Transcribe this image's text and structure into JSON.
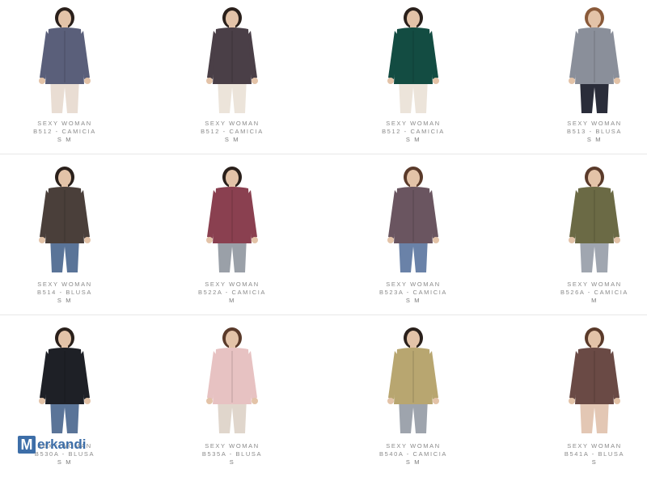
{
  "watermark": {
    "first_letter": "M",
    "rest": "erkandi"
  },
  "products": [
    {
      "brand": "SEXY WOMAN",
      "code": "B512 - CAMICIA",
      "sizes": "S  M",
      "top": "#5a5f7a",
      "pants": "#e9ddd3",
      "skin": "#e3c3a8",
      "hair": "#2a201b"
    },
    {
      "brand": "SEXY WOMAN",
      "code": "B512 - CAMICIA",
      "sizes": "S  M",
      "top": "#4a3f47",
      "pants": "#ece4da",
      "skin": "#e3c3a8",
      "hair": "#2a201b"
    },
    {
      "brand": "SEXY WOMAN",
      "code": "B512 - CAMICIA",
      "sizes": "S  M",
      "top": "#134c42",
      "pants": "#ece4da",
      "skin": "#e3c3a8",
      "hair": "#2a201b"
    },
    {
      "brand": "SEXY WOMAN",
      "code": "B513 - BLUSA",
      "sizes": "S  M",
      "top": "#8a8f9a",
      "pants": "#2a2d3a",
      "skin": "#e3c3a8",
      "hair": "#8a5a3a"
    },
    {
      "brand": "SEXY WOMAN",
      "code": "B514 - BLUSA",
      "sizes": "S  M",
      "top": "#4a3f3a",
      "pants": "#5a7498",
      "skin": "#e3c3a8",
      "hair": "#2a201b"
    },
    {
      "brand": "SEXY WOMAN",
      "code": "B522A - CAMICIA",
      "sizes": "M",
      "top": "#8a4050",
      "pants": "#9aa0a8",
      "skin": "#e3c3a8",
      "hair": "#2a201b"
    },
    {
      "brand": "SEXY WOMAN",
      "code": "B523A - CAMICIA",
      "sizes": "S  M",
      "top": "#6a5560",
      "pants": "#6a82a8",
      "skin": "#e3c3a8",
      "hair": "#5a3a2a"
    },
    {
      "brand": "SEXY WOMAN",
      "code": "B526A - CAMICIA",
      "sizes": "M",
      "top": "#6b6a45",
      "pants": "#a0a6b0",
      "skin": "#e3c3a8",
      "hair": "#5a3a2a"
    },
    {
      "brand": "SEXY WOMAN",
      "code": "B530A - BLUSA",
      "sizes": "S  M",
      "top": "#1e2026",
      "pants": "#5a7498",
      "skin": "#e3c3a8",
      "hair": "#2a201b"
    },
    {
      "brand": "SEXY WOMAN",
      "code": "B535A - BLUSA",
      "sizes": "S",
      "top": "#e7c2c2",
      "pants": "#e0d6cc",
      "skin": "#e3c3a8",
      "hair": "#5a3a2a"
    },
    {
      "brand": "SEXY WOMAN",
      "code": "B540A - CAMICIA",
      "sizes": "S  M",
      "top": "#b8a670",
      "pants": "#9ea4ad",
      "skin": "#e3c3a8",
      "hair": "#2a201b"
    },
    {
      "brand": "SEXY WOMAN",
      "code": "B541A - BLUSA",
      "sizes": "S",
      "top": "#6a4a45",
      "pants": "#e3c7b4",
      "skin": "#e3c3a8",
      "hair": "#5a3a2a"
    }
  ]
}
